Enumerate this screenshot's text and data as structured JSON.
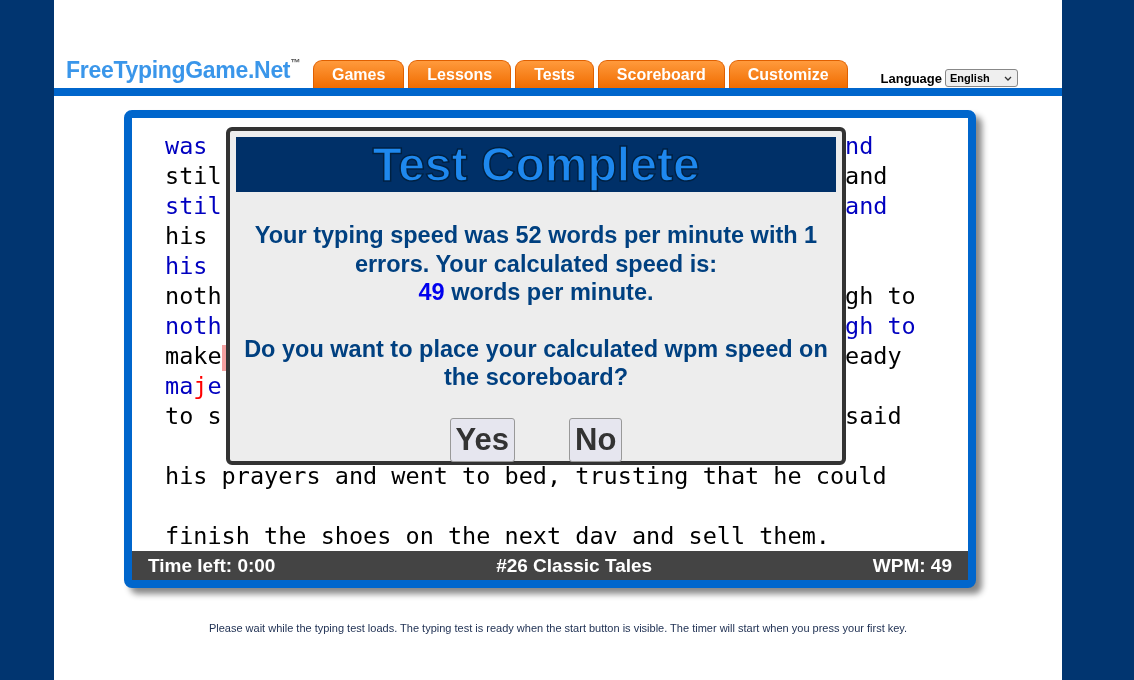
{
  "header": {
    "logo": "FreeTypingGame.Net$^{™}$",
    "tabs": [
      {
        "label": "Games",
        "selected": false
      },
      {
        "label": "Lessons",
        "selected": false
      },
      {
        "label": "Tests",
        "selected": false
      },
      {
        "label": "Scoreboard",
        "selected": false
      },
      {
        "label": "Customize",
        "selected": false
      }
    ],
    "language_label": "Language",
    "language_value": "English"
  },
  "test": {
    "lines": [
      {
        "kind": "typed",
        "cursor": false,
        "left": [
          {
            "text": "was",
            "error": false
          }
        ],
        "right": "nd"
      },
      {
        "kind": "original",
        "cursor": false,
        "left": [
          {
            "text": "stil",
            "error": false
          }
        ],
        "right": "and"
      },
      {
        "kind": "typed",
        "cursor": false,
        "left": [
          {
            "text": "stil",
            "error": false
          }
        ],
        "right": "and"
      },
      {
        "kind": "original",
        "cursor": false,
        "left": [
          {
            "text": "his",
            "error": false
          }
        ]
      },
      {
        "kind": "typed",
        "cursor": false,
        "left": [
          {
            "text": "his",
            "error": false
          }
        ]
      },
      {
        "kind": "original",
        "cursor": false,
        "left": [
          {
            "text": "noth",
            "error": false
          }
        ],
        "right": "gh to"
      },
      {
        "kind": "typed",
        "cursor": false,
        "left": [
          {
            "text": "noth",
            "error": false
          }
        ],
        "right": "gh to"
      },
      {
        "kind": "original",
        "cursor": true,
        "left": [
          {
            "text": "make",
            "error": false
          }
        ],
        "right": "eady"
      },
      {
        "kind": "typed",
        "cursor": false,
        "left": [
          {
            "text": "ma",
            "error": false
          },
          {
            "text": "j",
            "error": true
          },
          {
            "text": "e",
            "error": false
          }
        ]
      },
      {
        "kind": "original",
        "cursor": false,
        "left": [
          {
            "text": "to s",
            "error": false
          }
        ],
        "right": "said"
      },
      {
        "kind": "empty",
        "cursor": false
      },
      {
        "kind": "original",
        "cursor": false,
        "left": [
          {
            "text": "his prayers and went to bed, trusting that he could",
            "error": false
          }
        ]
      },
      {
        "kind": "empty",
        "cursor": false
      },
      {
        "kind": "original",
        "cursor": false,
        "left": [
          {
            "text": "finish the shoes on the next dav and sell them.",
            "error": false
          }
        ]
      }
    ],
    "status": {
      "time_left": "Time left: 0:00",
      "title": "#26 Classic Tales",
      "wpm": "WPM: 49"
    }
  },
  "dialog": {
    "title": "Test Complete",
    "message_before": "Your typing speed was 52 words per minute with 1 errors. Your calculated speed is:",
    "calculated_wpm": "49",
    "message_after": " words per minute.",
    "question": "Do you want to place your calculated wpm speed on the scoreboard?",
    "buttons": [
      "Yes",
      "No"
    ]
  },
  "footer_note": "Please wait while the typing test loads. The typing test is ready when the start button is visible. The timer will start when you press your first key."
}
